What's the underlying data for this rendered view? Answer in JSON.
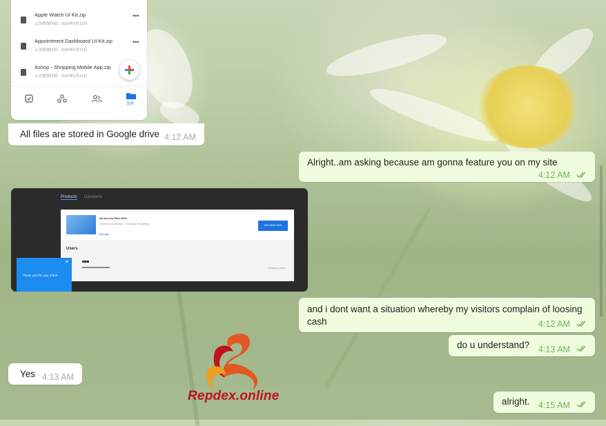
{
  "file_list": [
    {
      "name": "Apple Watch UI Kit.zip",
      "meta": "上次修改时间：2020年5月15日"
    },
    {
      "name": "Appointment Dashboard UI Kit.zip",
      "meta": "上次修改时间：2020年5月15日"
    },
    {
      "name": "Ashop - Shopping Mobile App.zip",
      "meta": "上次修改时间：2020年5月15日"
    }
  ],
  "file_more_glyph": "•••",
  "bottom_nav": {
    "active_tab_label": "文件",
    "icons": [
      "tasks-icon",
      "shared-icon",
      "people-icon",
      "folder-icon"
    ]
  },
  "dark_screenshot": {
    "tabs": [
      "Products",
      "Discounts"
    ],
    "product_title": "All Access Pass Elite",
    "product_desc": "Create new license / 100 days remaining",
    "product_link": "Manage",
    "product_button": "ADD NEW ITEM",
    "section_title": "Users",
    "row_right": "Primary Users",
    "popup_text": "Thank you for your order!"
  },
  "messages": [
    {
      "id": "m1",
      "direction": "in",
      "text": "All files are stored in Google drive",
      "time": "4:12 AM"
    },
    {
      "id": "m2",
      "direction": "out",
      "text": "Alright..am asking because am gonna feature you on my site",
      "time": "4:12 AM",
      "read": true
    },
    {
      "id": "m3",
      "direction": "out",
      "text": "and i dont want a situation whereby my visitors complain of loosing cash",
      "time": "4:12 AM",
      "read": true
    },
    {
      "id": "m4",
      "direction": "out",
      "text": "do u understand?",
      "time": "4:13 AM",
      "read": true
    },
    {
      "id": "m5",
      "direction": "in",
      "text": "Yes",
      "time": "4:13 AM"
    },
    {
      "id": "m6",
      "direction": "out",
      "text": "alright.",
      "time": "4:15 AM",
      "read": true
    }
  ],
  "watermark": {
    "text": "Repdex.online"
  },
  "colors": {
    "incoming_bubble": "#ffffff",
    "outgoing_bubble": "#effdde",
    "outgoing_time": "#6fb25a",
    "incoming_time": "#a2acb4",
    "watermark": "#c1121f"
  }
}
